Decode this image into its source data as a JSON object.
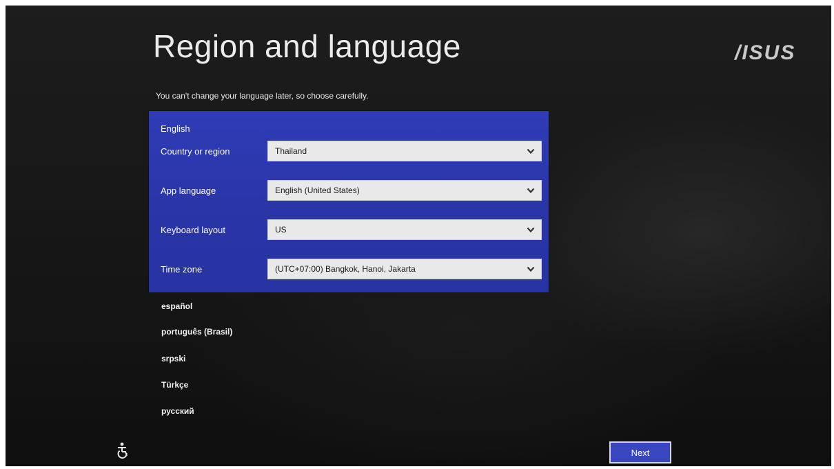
{
  "header": {
    "title": "Region and language",
    "brand": "/ISUS"
  },
  "subtitle": "You can't change your language later, so choose carefully.",
  "selected_language": {
    "name": "English",
    "settings": [
      {
        "label": "Country or region",
        "value": "Thailand"
      },
      {
        "label": "App language",
        "value": "English (United States)"
      },
      {
        "label": "Keyboard layout",
        "value": "US"
      },
      {
        "label": "Time zone",
        "value": "(UTC+07:00) Bangkok, Hanoi, Jakarta"
      }
    ]
  },
  "other_languages": [
    "español",
    "português (Brasil)",
    "srpski",
    "Türkçe",
    "русский"
  ],
  "footer": {
    "accessibility_icon": "ease-of-access-icon",
    "next_label": "Next"
  },
  "colors": {
    "panel_blue": "#2f3cb6",
    "background": "#161616",
    "dropdown_bg": "#e9e9e9",
    "button_blue": "#3a45c0"
  }
}
